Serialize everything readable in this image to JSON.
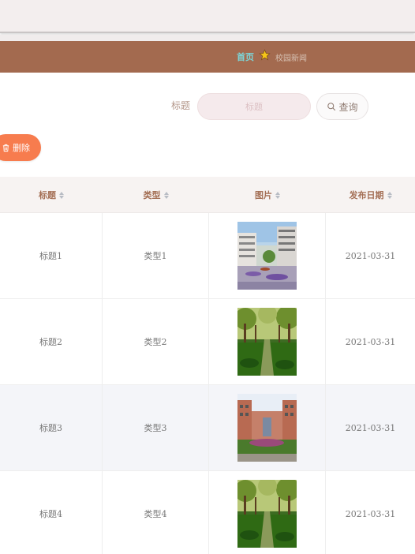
{
  "breadcrumb": {
    "home": "首页",
    "current": "校园新闻",
    "star_color": "#f5c518"
  },
  "search": {
    "label": "标题",
    "placeholder": "标题",
    "query_label": "查询"
  },
  "actions": {
    "delete_label": "删除"
  },
  "table": {
    "columns": [
      "标题",
      "类型",
      "图片",
      "发布日期"
    ],
    "rows": [
      {
        "title": "标题1",
        "type": "类型1",
        "image": "campus-building-courtyard",
        "date": "2021-03-31"
      },
      {
        "title": "标题2",
        "type": "类型2",
        "image": "tree-lined-path",
        "date": "2021-03-31"
      },
      {
        "title": "标题3",
        "type": "类型3",
        "image": "campus-building-garden",
        "date": "2021-03-31"
      },
      {
        "title": "标题4",
        "type": "类型4",
        "image": "tree-lined-path",
        "date": "2021-03-31"
      }
    ]
  },
  "colors": {
    "nav_bar": "#a36a4f",
    "delete_button": "#f77c4e",
    "header_text": "#a46f55"
  }
}
